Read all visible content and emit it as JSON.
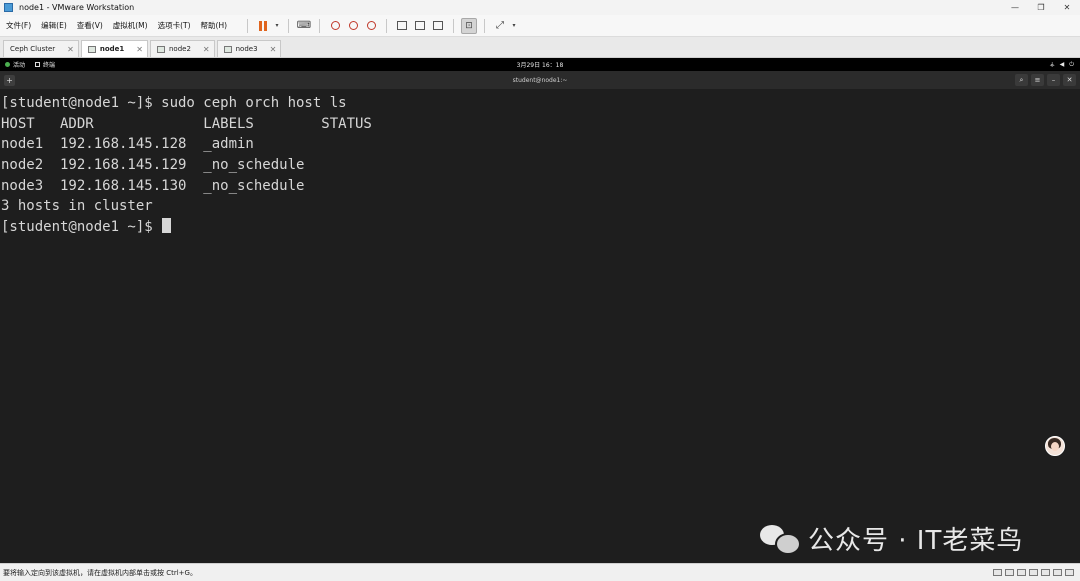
{
  "window": {
    "title": "node1 - VMware Workstation",
    "controls": [
      "—",
      "❐",
      "✕"
    ]
  },
  "menu": {
    "items": [
      "文件(F)",
      "编辑(E)",
      "查看(V)",
      "虚拟机(M)",
      "选项卡(T)",
      "帮助(H)"
    ]
  },
  "tabs": [
    {
      "label": "Ceph Cluster",
      "active": false
    },
    {
      "label": "node1",
      "active": true
    },
    {
      "label": "node2",
      "active": false
    },
    {
      "label": "node3",
      "active": false
    }
  ],
  "gnome": {
    "activities": "活动",
    "terminal_app": "终端",
    "clock": "3月29日 16：18"
  },
  "terminal": {
    "title": "student@node1:~",
    "lines": [
      "[student@node1 ~]$ sudo ceph orch host ls",
      "HOST   ADDR             LABELS        STATUS",
      "node1  192.168.145.128  _admin",
      "node2  192.168.145.129  _no_schedule",
      "node3  192.168.145.130  _no_schedule",
      "3 hosts in cluster",
      "[student@node1 ~]$ "
    ]
  },
  "watermark": "公众号 · IT老菜鸟",
  "statusbar": {
    "message": "要将输入定向到该虚拟机，请在虚拟机内部单击或按 Ctrl+G。"
  }
}
